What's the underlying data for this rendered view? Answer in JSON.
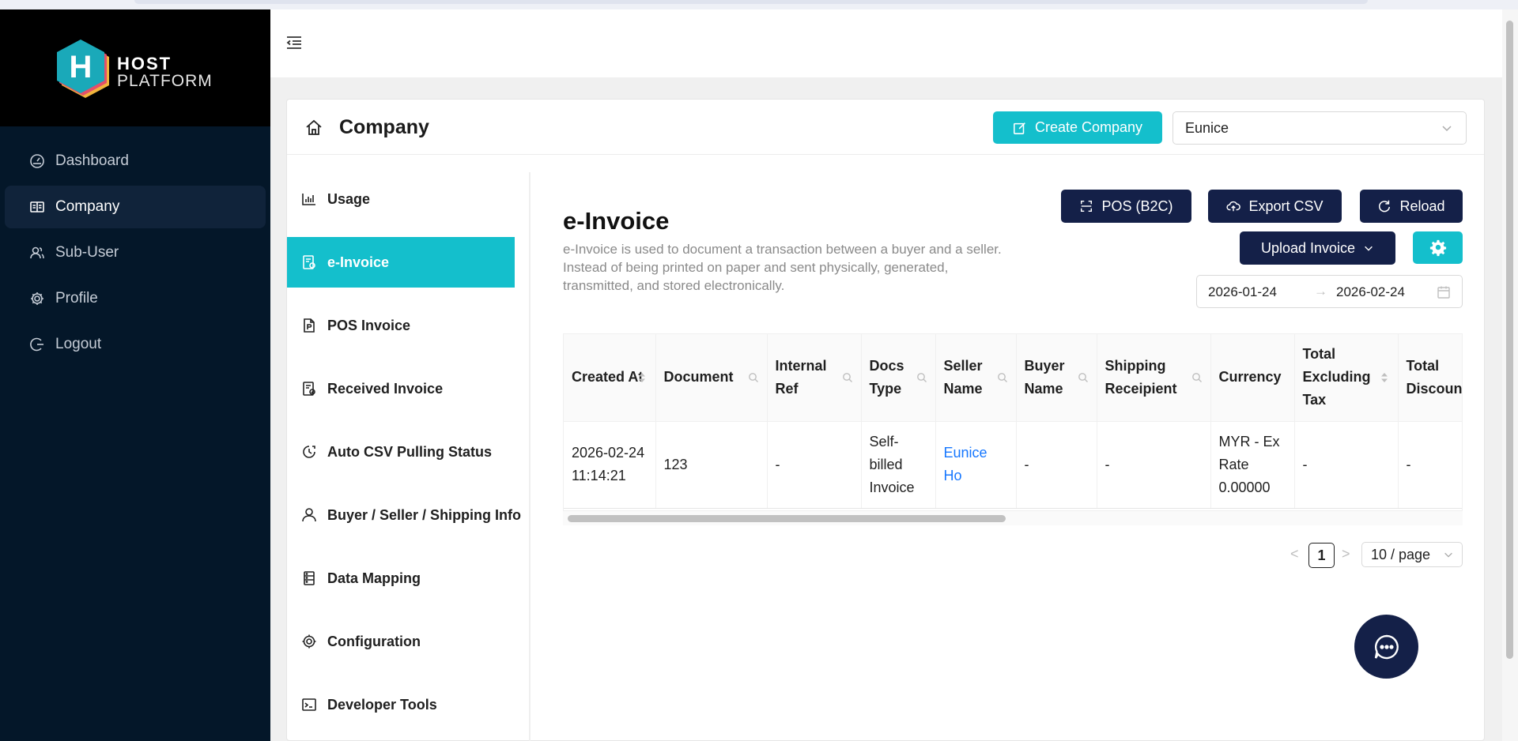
{
  "brand": {
    "logo_letter": "H",
    "name_line1": "HOST",
    "name_line2": "PLATFORM",
    "colors": {
      "teal": "#14BFCC",
      "navy": "#142048",
      "sidebar_bg": "#041729"
    }
  },
  "sidebar": {
    "items": [
      {
        "label": "Dashboard",
        "icon": "dashboard-icon",
        "active": false
      },
      {
        "label": "Company",
        "icon": "book-icon",
        "active": true
      },
      {
        "label": "Sub-User",
        "icon": "users-icon",
        "active": false
      },
      {
        "label": "Profile",
        "icon": "gear-icon",
        "active": false
      },
      {
        "label": "Logout",
        "icon": "logout-icon",
        "active": false
      }
    ]
  },
  "page": {
    "title": "Company",
    "create_button": "Create Company",
    "company_select": "Eunice"
  },
  "inner_menu": {
    "items": [
      {
        "label": "Usage",
        "icon": "bar-chart-icon",
        "active": false
      },
      {
        "label": "e-Invoice",
        "icon": "invoice-icon",
        "active": true
      },
      {
        "label": "POS Invoice",
        "icon": "pos-file-icon",
        "active": false
      },
      {
        "label": "Received Invoice",
        "icon": "received-file-icon",
        "active": false
      },
      {
        "label": "Auto CSV Pulling Status",
        "icon": "clock-icon",
        "active": false
      },
      {
        "label": "Buyer / Seller / Shipping Info",
        "icon": "user-icon",
        "active": false
      },
      {
        "label": "Data Mapping",
        "icon": "database-icon",
        "active": false
      },
      {
        "label": "Configuration",
        "icon": "gear-icon",
        "active": false
      },
      {
        "label": "Developer Tools",
        "icon": "terminal-icon",
        "active": false
      }
    ]
  },
  "content": {
    "title": "e-Invoice",
    "description": "e-Invoice is used to document a transaction between a buyer and a seller. Instead of being printed on paper and sent physically, generated, transmitted, and stored electronically.",
    "buttons": {
      "pos": "POS (B2C)",
      "export": "Export CSV",
      "reload": "Reload",
      "upload": "Upload Invoice"
    },
    "date_from": "2026-01-24",
    "date_to": "2026-02-24",
    "date_separator": "→"
  },
  "table": {
    "columns": [
      "Created At",
      "Document",
      "Internal Ref",
      "Docs Type",
      "Seller Name",
      "Buyer Name",
      "Shipping Receipient",
      "Currency",
      "Total Excluding Tax",
      "Total Discoun"
    ],
    "rows": [
      [
        "2026-02-24 11:14:21",
        "123",
        "-",
        "Self-billed Invoice",
        "Eunice Ho",
        "-",
        "-",
        "MYR - Ex Rate 0.00000",
        "-",
        "-"
      ]
    ]
  },
  "pagination": {
    "prev": "<",
    "current": "1",
    "next": ">",
    "page_size": "10 / page"
  }
}
